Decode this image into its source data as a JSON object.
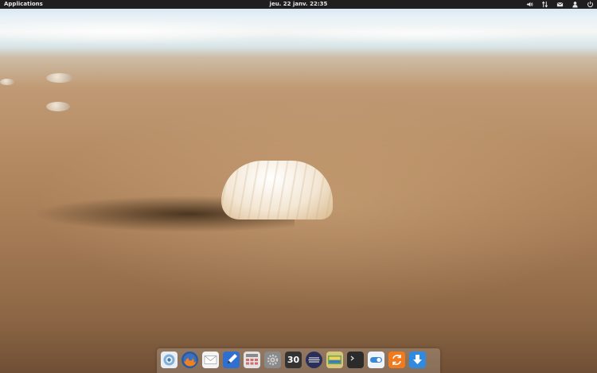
{
  "top_panel": {
    "applications_label": "Applications",
    "datetime": "jeu. 22 janv. 22:35",
    "indicators": [
      {
        "icon": "volume-icon"
      },
      {
        "icon": "network-icon"
      },
      {
        "icon": "mail-icon"
      },
      {
        "icon": "user-icon"
      },
      {
        "icon": "power-icon"
      }
    ]
  },
  "dock": {
    "items": [
      {
        "icon": "midori-browser-icon",
        "color": "#8fb9dc"
      },
      {
        "icon": "firefox-icon",
        "color": "#e8721c"
      },
      {
        "icon": "mail-app-icon",
        "color": "#f2f2f2"
      },
      {
        "icon": "scratch-editor-icon",
        "color": "#2f6fd0"
      },
      {
        "icon": "calculator-icon",
        "color": "#d9d9d9"
      },
      {
        "icon": "settings-icon",
        "color": "#8a8a8a"
      },
      {
        "icon": "calendar-icon",
        "color": "#333333",
        "label": "30"
      },
      {
        "icon": "music-player-icon",
        "color": "#2a2f5a"
      },
      {
        "icon": "photos-icon",
        "color": "#6aa84f"
      },
      {
        "icon": "terminal-icon",
        "color": "#2b2b2b"
      },
      {
        "icon": "switchboard-icon",
        "color": "#eef3f8"
      },
      {
        "icon": "update-manager-icon",
        "color": "#f07a1c"
      },
      {
        "icon": "downloads-icon",
        "color": "#2f8ae0"
      }
    ]
  }
}
